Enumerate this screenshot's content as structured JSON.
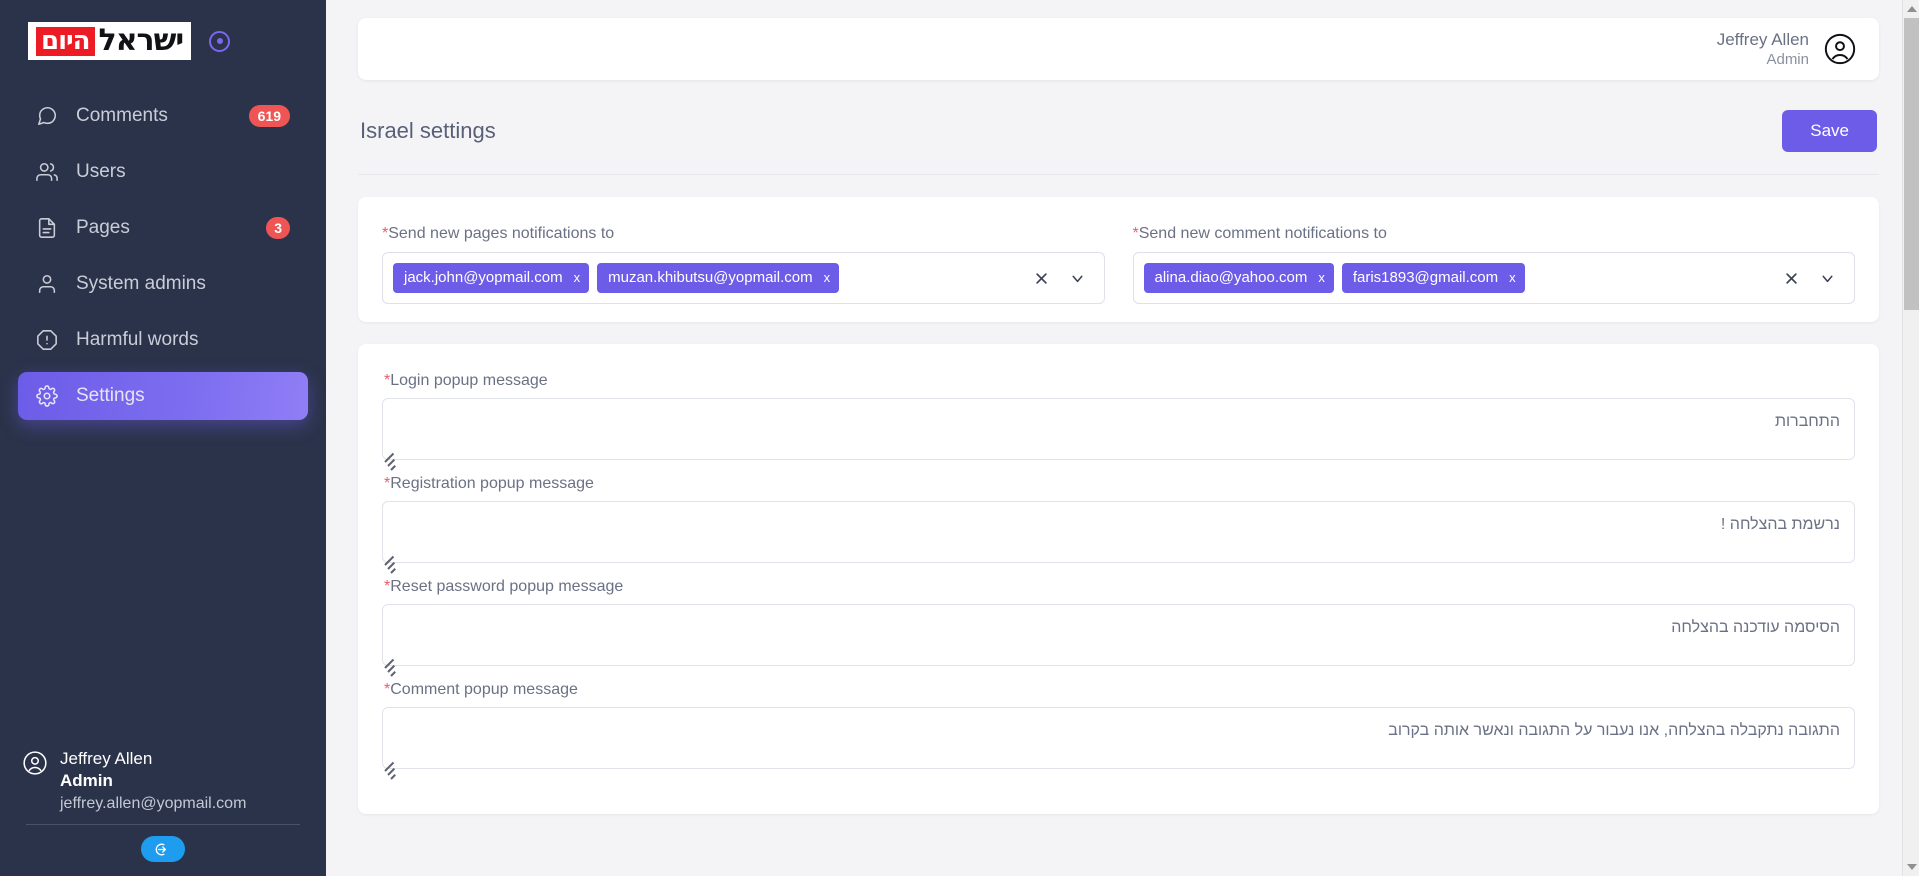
{
  "colors": {
    "sidebar_bg": "#2a3349",
    "accent_purple": "#6c5ce7",
    "badge_red": "#f05555",
    "logout_blue": "#1e9cf0",
    "logo_red": "#ed1c24",
    "page_bg": "#f4f4f6",
    "required_star": "#ef5b6b"
  },
  "sidebar": {
    "logo": {
      "text_black": "ישראל",
      "text_red_box": "היום",
      "icon": "target-dot-icon"
    },
    "items": [
      {
        "label": "Comments",
        "icon": "comment-bubble-icon",
        "badge": "619",
        "active": false
      },
      {
        "label": "Users",
        "icon": "users-icon",
        "badge": "",
        "active": false
      },
      {
        "label": "Pages",
        "icon": "document-icon",
        "badge": "3",
        "active": false
      },
      {
        "label": "System admins",
        "icon": "user-icon",
        "badge": "",
        "active": false
      },
      {
        "label": "Harmful words",
        "icon": "alert-octagon-icon",
        "badge": "",
        "active": false
      },
      {
        "label": "Settings",
        "icon": "gear-icon",
        "badge": "",
        "active": true
      }
    ],
    "footer": {
      "name": "Jeffrey Allen",
      "role": "Admin",
      "email": "jeffrey.allen@yopmail.com",
      "avatar_icon": "user-circle-icon",
      "logout_icon": "logout-icon"
    }
  },
  "topbar": {
    "name": "Jeffrey Allen",
    "role": "Admin",
    "avatar_icon": "user-circle-icon"
  },
  "page": {
    "title": "Israel settings",
    "save_label": "Save"
  },
  "notifications": {
    "pages": {
      "label": "Send new pages notifications to",
      "required": "*",
      "tags": [
        "jack.john@yopmail.com",
        "muzan.khibutsu@yopmail.com"
      ],
      "tag_remove": "x",
      "clear_icon": "clear-x-icon",
      "chevron_icon": "chevron-down-icon"
    },
    "comments": {
      "label": "Send new comment notifications to",
      "required": "*",
      "tags": [
        "alina.diao@yahoo.com",
        "faris1893@gmail.com"
      ],
      "tag_remove": "x",
      "clear_icon": "clear-x-icon",
      "chevron_icon": "chevron-down-icon"
    }
  },
  "messages": [
    {
      "label": "Login popup message",
      "required": "*",
      "value": "התחברות"
    },
    {
      "label": "Registration popup message",
      "required": "*",
      "value": "נרשמת בהצלחה !"
    },
    {
      "label": "Reset password popup message",
      "required": "*",
      "value": "הסיסמה עודכנה בהצלחה"
    },
    {
      "label": "Comment popup message",
      "required": "*",
      "value": "התגובה נתקבלה בהצלחה, אנו נעבור על התגובה ונאשר אותה בקרוב"
    }
  ],
  "scrollbar": {
    "up_arrow": "scroll-up-arrow",
    "down_arrow": "scroll-down-arrow"
  }
}
